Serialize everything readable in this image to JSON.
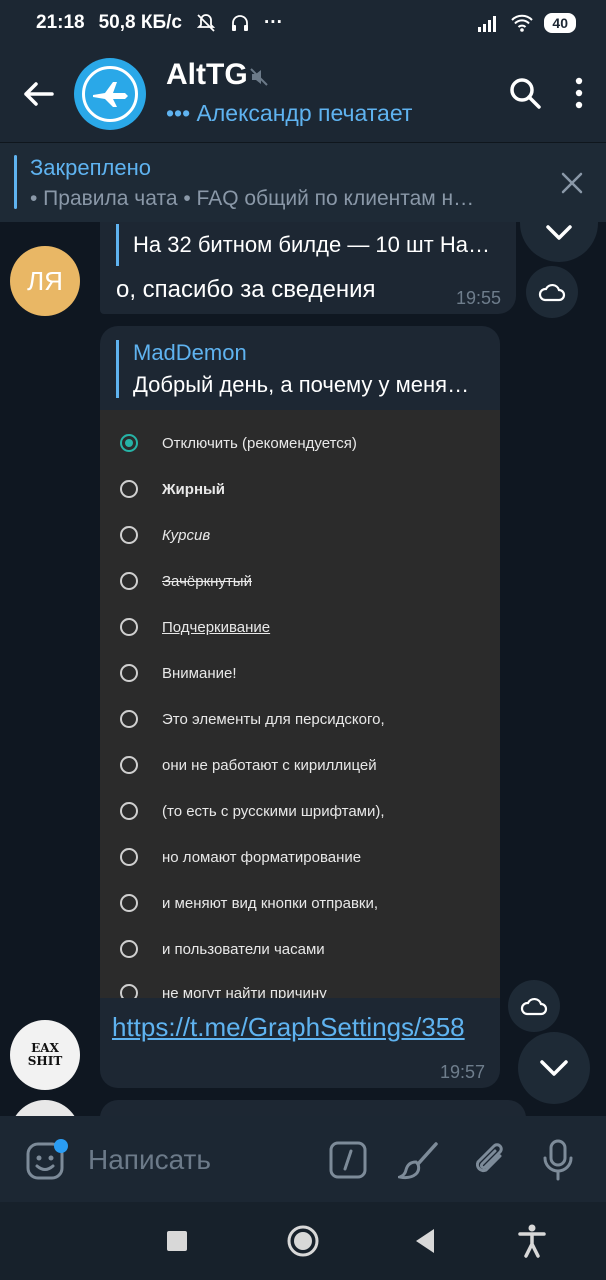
{
  "status_bar": {
    "time": "21:18",
    "speed": "50,8 КБ/с",
    "extra": "···",
    "battery": "40"
  },
  "header": {
    "title": "AltTG",
    "status": "••• Александр печатает"
  },
  "pinned": {
    "title": "Закреплено",
    "text": "• Правила чата  • FAQ общий по клиентам н…"
  },
  "messages": {
    "m1": {
      "reply_text": "На 32 битном билде — 10 шт На…",
      "text": "о, спасибо за сведения",
      "time": "19:55",
      "avatar_initials": "ЛЯ"
    },
    "m2": {
      "reply_name": "MadDemon",
      "reply_text": "Добрый день, а почему у меня…",
      "options": [
        "Отключить (рекомендуется)",
        "Жирный",
        "Курсив",
        "Зачёркнутый",
        "Подчеркивание",
        "Внимание!",
        "Это элементы для персидского,",
        "они не работают с кириллицей",
        "(то есть с русскими шрифтами),",
        "но ломают форматирование",
        "и меняют вид кнопки отправки,",
        "и пользователи часами",
        "не могут найти причину"
      ],
      "selected_index": 0,
      "link": "https://t.me/GraphSettings/358",
      "time": "19:57",
      "avatar_label": "EAX SHIT"
    }
  },
  "composer": {
    "placeholder": "Написать"
  },
  "colors": {
    "accent": "#5fb3f0",
    "radio_selected": "#26b3a6",
    "avatar_ly": "#e9b765"
  }
}
